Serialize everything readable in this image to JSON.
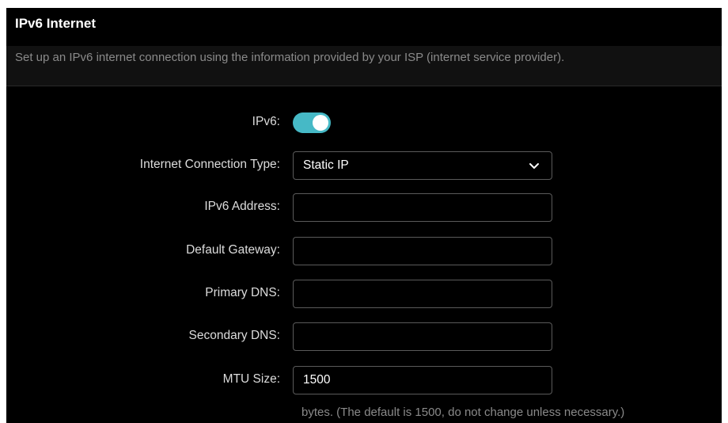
{
  "section": {
    "title": "IPv6 Internet",
    "description": "Set up an IPv6 internet connection using the information provided by your ISP (internet service provider)."
  },
  "form": {
    "ipv6": {
      "label": "IPv6:",
      "enabled": true
    },
    "connection_type": {
      "label": "Internet Connection Type:",
      "value": "Static IP"
    },
    "ipv6_address": {
      "label": "IPv6 Address:",
      "value": ""
    },
    "default_gateway": {
      "label": "Default Gateway:",
      "value": ""
    },
    "primary_dns": {
      "label": "Primary DNS:",
      "value": ""
    },
    "secondary_dns": {
      "label": "Secondary DNS:",
      "value": ""
    },
    "mtu_size": {
      "label": "MTU Size:",
      "value": "1500"
    },
    "mtu_hint": "bytes. (The default is 1500, do not change unless necessary.)"
  },
  "colors": {
    "background": "#000000",
    "toggle_on": "#46b9c6",
    "text": "#dcdcdc",
    "muted_text": "#8a8a8a",
    "field_border": "#5a5a5a"
  },
  "icons": {
    "dropdown": "chevron-down-icon"
  }
}
